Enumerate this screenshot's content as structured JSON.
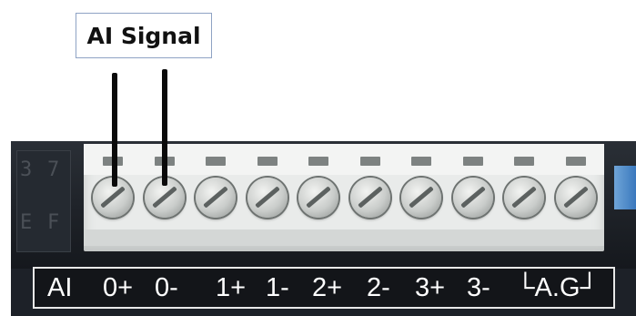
{
  "callout": {
    "text": "AI Signal"
  },
  "terminal_labels": [
    "AI",
    "0+",
    "0-",
    "1+",
    "1-",
    "2+",
    "2-",
    "3+",
    "3-",
    "└A.G┘"
  ],
  "ghost_digits": [
    "3",
    "7",
    "E",
    "F"
  ],
  "colors": {
    "body": "#1d2128",
    "block": "#e9ebea",
    "strip": "#131519",
    "accent": "#3a78bd"
  },
  "screw_count": 10
}
